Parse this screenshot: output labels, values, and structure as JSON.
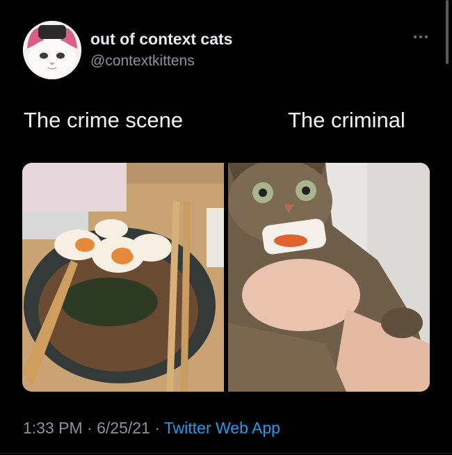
{
  "author": {
    "display_name": "out of context cats",
    "handle": "@contextkittens",
    "avatar_icon": "cat-avatar"
  },
  "post": {
    "more_icon": "more-horizontal-icon",
    "captions": {
      "left": "The crime scene",
      "right": "The criminal"
    },
    "images": [
      {
        "icon": "ramen-bowl-photo"
      },
      {
        "icon": "tabby-cat-with-egg-photo"
      }
    ],
    "time": "1:33 PM",
    "separator": " · ",
    "date": "6/25/21",
    "source": "Twitter Web App"
  },
  "colors": {
    "background": "#000000",
    "primary_text": "#e7e9ea",
    "secondary_text": "#8b949b",
    "link": "#1d9bf0"
  }
}
